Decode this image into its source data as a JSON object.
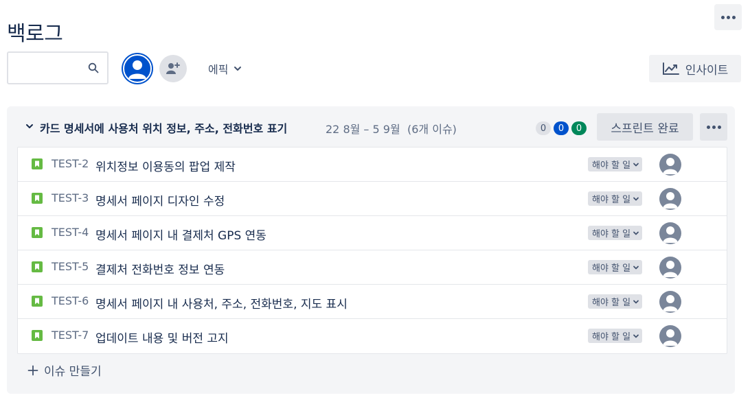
{
  "page": {
    "title": "백로그"
  },
  "toolbar": {
    "search_placeholder": "",
    "epic_label": "에픽",
    "insight_label": "인사이트"
  },
  "sprint": {
    "name": "카드 명세서에 사용처 위치 정보, 주소, 전화번호 표기",
    "dates": "22 8월 – 5 9월",
    "issue_count": "(6개 이슈)",
    "badges": {
      "todo": "0",
      "in_progress": "0",
      "done": "0"
    },
    "complete_label": "스프린트 완료",
    "issues": [
      {
        "key": "TEST-2",
        "summary": "위치정보 이용동의 팝업 제작",
        "status": "해야 할 일"
      },
      {
        "key": "TEST-3",
        "summary": "명세서 페이지 디자인 수정",
        "status": "해야 할 일"
      },
      {
        "key": "TEST-4",
        "summary": "명세서 페이지 내 결제처 GPS 연동",
        "status": "해야 할 일"
      },
      {
        "key": "TEST-5",
        "summary": "결제처 전화번호 정보 연동",
        "status": "해야 할 일"
      },
      {
        "key": "TEST-6",
        "summary": "명세서 페이지 내 사용처, 주소, 전화번호, 지도 표시",
        "status": "해야 할 일"
      },
      {
        "key": "TEST-7",
        "summary": "업데이트 내용 및 버전 고지",
        "status": "해야 할 일"
      }
    ],
    "create_issue_label": "이슈 만들기"
  },
  "colors": {
    "brand_blue": "#0052cc",
    "done_green": "#00875a",
    "story_green": "#65ba43",
    "text_primary": "#172b4d",
    "text_subtle": "#5e6c84"
  },
  "icons": {
    "more": "more-dots-icon",
    "search": "search-icon",
    "avatar": "user-avatar-icon",
    "add_people": "add-people-icon",
    "chevron": "chevron-down-icon",
    "insight": "trend-chart-icon",
    "story": "story-bookmark-icon",
    "plus": "plus-icon"
  }
}
